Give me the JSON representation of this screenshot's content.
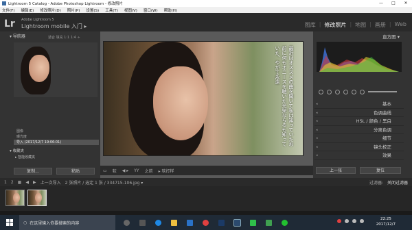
{
  "window": {
    "title": "Lightroom 5 Catalog - Adobe Photoshop Lightroom - 修改照片",
    "controls": [
      "—",
      "□",
      "✕"
    ]
  },
  "menu": [
    "文件(F)",
    "编辑(E)",
    "修改照片(D)",
    "照片(P)",
    "设置(S)",
    "工具(T)",
    "视图(V)",
    "窗口(W)",
    "帮助(H)"
  ],
  "identity": {
    "logo": "Lr",
    "catalog": "Adobe Lightroom 5",
    "mobile": "Lightroom mobile 入门 ▸"
  },
  "modules": [
    "图库",
    "修改照片",
    "地图",
    "画册",
    "Web"
  ],
  "active_module": "修改照片",
  "left": {
    "navigator": "▾ 导航器",
    "nav_modes": "适合  填充  1:1  1:4 ÷",
    "history": [
      "图像",
      "曝光度",
      "导入 (2017/12/7 19:06:01)"
    ],
    "collections": "▾ 收藏夹",
    "smart": "▸ 智能收藏夹",
    "copy": "复制...",
    "paste": "粘贴"
  },
  "photo_text": "最近はオススメの曲を聞いて私は知っていたお前に何もオニースを聴いた光栄ならるも知っていた、やがて永遠",
  "toolbar": {
    "items": [
      "▭",
      "软",
      "◀ ▸",
      "YY",
      "之前",
      "▸ 软打样"
    ]
  },
  "right": {
    "header": "直方图 ▾",
    "sections": [
      "基本",
      "色调曲线",
      "HSL / 颜色 / 黑白",
      "分离色调",
      "细节",
      "镜头校正",
      "效果"
    ],
    "prev": "上一张",
    "reset": "复位"
  },
  "filmbar": {
    "items": [
      "1",
      "2",
      "▦",
      "◀",
      "▶",
      "上一次导入",
      "2 张照片 / 选定 1 张 / 334715-106.jpg ▾",
      "过滤器:",
      "关闭过滤器"
    ]
  },
  "taskbar": {
    "search": "在这里输入你要搜索的内容",
    "time": "22:25",
    "date": "2017/12/7"
  }
}
